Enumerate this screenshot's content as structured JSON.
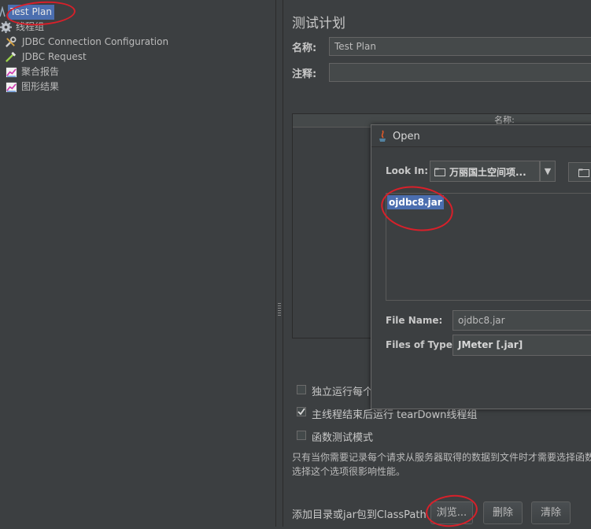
{
  "tree": {
    "items": [
      {
        "label": "Test Plan",
        "icon": "test-plan-icon",
        "selected": true
      },
      {
        "label": "线程组",
        "icon": "gear-icon"
      },
      {
        "label": "JDBC Connection Configuration",
        "icon": "wrench-icon"
      },
      {
        "label": "JDBC Request",
        "icon": "pipette-icon"
      },
      {
        "label": "聚合报告",
        "icon": "chart-icon"
      },
      {
        "label": "图形结果",
        "icon": "chart-icon"
      }
    ]
  },
  "panel": {
    "title": "测试计划",
    "name_label": "名称:",
    "name_value": "Test Plan",
    "comment_label": "注释:",
    "comment_value": "",
    "table_header": "名称:",
    "checkbox1_label": "独立运行每个",
    "checkbox1_checked": false,
    "checkbox2_label": "主线程结束后运行 tearDown线程组",
    "checkbox2_checked": true,
    "checkbox3_label": "函数测试模式",
    "checkbox3_checked": false,
    "note_line1": "只有当你需要记录每个请求从服务器取得的数据到文件时才需要选择函数",
    "note_line2": "选择这个选项很影响性能。",
    "classpath_label": "添加目录或jar包到ClassPath",
    "browse_button": "浏览...",
    "delete_button": "删除",
    "clear_button": "清除"
  },
  "dialog": {
    "title": "Open",
    "look_in_label": "Look In:",
    "look_in_value": "万丽国土空间项...",
    "file_item": "ojdbc8.jar",
    "file_name_label": "File Name:",
    "file_name_value": "ojdbc8.jar",
    "file_type_label": "Files of Type:",
    "file_type_value": "JMeter [.jar]"
  },
  "colors": {
    "background": "#3c3f41",
    "selection": "#4b6eaf",
    "annotation": "#d8202a"
  }
}
